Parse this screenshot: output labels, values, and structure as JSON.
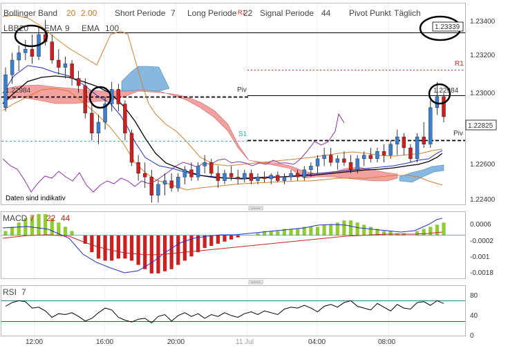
{
  "legend": {
    "bollinger_label": "Bollinger Band",
    "bollinger_period": "20",
    "bollinger_dev": "2.00",
    "short_label": "Short Periode",
    "short_value": "7",
    "long_label": "Long Periode",
    "long_value": "22",
    "signal_label": "Signal Periode",
    "signal_value": "44",
    "pivot_label": "Pivot Punkt",
    "pivot_value": "Täglich",
    "r1_marker": "R1",
    "line2_overlap": "LBB20",
    "ema9_label": "EMA",
    "ema9_value": "9",
    "ema100_label": "EMA",
    "ema100_value": "100"
  },
  "main_chart": {
    "price_labels": {
      "high_box": "1.23339",
      "piv_left": "1.22984",
      "piv_right": "1.22984",
      "last": "1.22825"
    },
    "level_labels": {
      "piv": "Piv",
      "r1": "R1",
      "s1": "S1",
      "piv_right": "Piv"
    },
    "note": "Daten sind indikativ",
    "y_ticks": [
      "1.23400",
      "1.23200",
      "1.23000",
      "1.22600",
      "1.22400"
    ]
  },
  "macd_panel": {
    "label": "MACD",
    "p1": "7",
    "p2": "22",
    "p3": "44",
    "y_ticks": [
      "0.0006",
      "-0.0002",
      "-0.001",
      "-0.0018"
    ]
  },
  "rsi_panel": {
    "label": "RSI",
    "period": "7",
    "y_ticks": [
      "80",
      "40",
      "0"
    ]
  },
  "x_ticks": [
    "12:00",
    "16:00",
    "20:00",
    "11 Jul",
    "04:00",
    "08:00"
  ],
  "colors": {
    "up_candle": "#3a7fd0",
    "down_candle": "#cc1f1f",
    "cloud_bull": "#f08f8f",
    "cloud_bear": "#7ab0dc",
    "bb_band": "#d47f2b",
    "ema_fast": "#1f2fc9",
    "ema_slow": "#000000",
    "macd_pos": "#8fcc2f",
    "macd_neg": "#cc1f1f",
    "lagging": "#8a2fb0",
    "rsi_line": "#000000",
    "rsi_bounds": "#2f7f9f"
  },
  "chart_data": {
    "type": "candlestick",
    "title": "",
    "x_labels": [
      "12:00",
      "16:00",
      "20:00",
      "11 Jul",
      "04:00",
      "08:00"
    ],
    "ylim": [
      1.2235,
      1.2345
    ],
    "pivot_levels": {
      "R1": 1.2318,
      "Piv": 1.22984,
      "S1": 1.2276,
      "Piv_right": 1.2273
    },
    "last_price": 1.22825,
    "high_marker": 1.23339,
    "candles": [
      {
        "o": 1.2288,
        "h": 1.231,
        "l": 1.2286,
        "c": 1.2306
      },
      {
        "o": 1.2306,
        "h": 1.2318,
        "l": 1.2301,
        "c": 1.2314
      },
      {
        "o": 1.2314,
        "h": 1.2322,
        "l": 1.2308,
        "c": 1.2318
      },
      {
        "o": 1.2318,
        "h": 1.2325,
        "l": 1.2314,
        "c": 1.232
      },
      {
        "o": 1.232,
        "h": 1.2328,
        "l": 1.2312,
        "c": 1.2316
      },
      {
        "o": 1.2316,
        "h": 1.2332,
        "l": 1.2314,
        "c": 1.2328
      },
      {
        "o": 1.2328,
        "h": 1.2336,
        "l": 1.2322,
        "c": 1.2324
      },
      {
        "o": 1.2324,
        "h": 1.2328,
        "l": 1.2312,
        "c": 1.2314
      },
      {
        "o": 1.2314,
        "h": 1.232,
        "l": 1.2306,
        "c": 1.231
      },
      {
        "o": 1.231,
        "h": 1.2316,
        "l": 1.2304,
        "c": 1.2312
      },
      {
        "o": 1.2312,
        "h": 1.2314,
        "l": 1.23,
        "c": 1.2304
      },
      {
        "o": 1.2304,
        "h": 1.2308,
        "l": 1.2296,
        "c": 1.23
      },
      {
        "o": 1.23,
        "h": 1.2304,
        "l": 1.2282,
        "c": 1.2285
      },
      {
        "o": 1.2285,
        "h": 1.229,
        "l": 1.227,
        "c": 1.2274
      },
      {
        "o": 1.2274,
        "h": 1.2284,
        "l": 1.2268,
        "c": 1.228
      },
      {
        "o": 1.228,
        "h": 1.2294,
        "l": 1.2276,
        "c": 1.229
      },
      {
        "o": 1.229,
        "h": 1.2302,
        "l": 1.2286,
        "c": 1.2298
      },
      {
        "o": 1.2298,
        "h": 1.2301,
        "l": 1.2286,
        "c": 1.229
      },
      {
        "o": 1.229,
        "h": 1.2292,
        "l": 1.227,
        "c": 1.2274
      },
      {
        "o": 1.2274,
        "h": 1.2276,
        "l": 1.2256,
        "c": 1.2258
      },
      {
        "o": 1.2258,
        "h": 1.2262,
        "l": 1.2248,
        "c": 1.2252
      },
      {
        "o": 1.2252,
        "h": 1.2258,
        "l": 1.2244,
        "c": 1.225
      },
      {
        "o": 1.225,
        "h": 1.2254,
        "l": 1.2236,
        "c": 1.224
      },
      {
        "o": 1.224,
        "h": 1.2248,
        "l": 1.2236,
        "c": 1.2246
      },
      {
        "o": 1.2246,
        "h": 1.2252,
        "l": 1.224,
        "c": 1.2248
      },
      {
        "o": 1.2248,
        "h": 1.2252,
        "l": 1.2242,
        "c": 1.2244
      },
      {
        "o": 1.2244,
        "h": 1.2252,
        "l": 1.2242,
        "c": 1.225
      },
      {
        "o": 1.225,
        "h": 1.2256,
        "l": 1.2246,
        "c": 1.2254
      },
      {
        "o": 1.2254,
        "h": 1.2258,
        "l": 1.2248,
        "c": 1.225
      },
      {
        "o": 1.225,
        "h": 1.2258,
        "l": 1.2248,
        "c": 1.2256
      },
      {
        "o": 1.2256,
        "h": 1.2262,
        "l": 1.2252,
        "c": 1.2258
      },
      {
        "o": 1.2258,
        "h": 1.226,
        "l": 1.225,
        "c": 1.2252
      },
      {
        "o": 1.2252,
        "h": 1.2256,
        "l": 1.2244,
        "c": 1.2248
      },
      {
        "o": 1.2248,
        "h": 1.2254,
        "l": 1.2246,
        "c": 1.2252
      },
      {
        "o": 1.2252,
        "h": 1.2256,
        "l": 1.2248,
        "c": 1.225
      },
      {
        "o": 1.225,
        "h": 1.2254,
        "l": 1.2246,
        "c": 1.2249
      },
      {
        "o": 1.2249,
        "h": 1.2254,
        "l": 1.2247,
        "c": 1.2252
      },
      {
        "o": 1.2252,
        "h": 1.2254,
        "l": 1.2246,
        "c": 1.2248
      },
      {
        "o": 1.2248,
        "h": 1.2252,
        "l": 1.2246,
        "c": 1.225
      },
      {
        "o": 1.225,
        "h": 1.2253,
        "l": 1.2247,
        "c": 1.2249
      },
      {
        "o": 1.2249,
        "h": 1.2252,
        "l": 1.2246,
        "c": 1.2251
      },
      {
        "o": 1.2251,
        "h": 1.2253,
        "l": 1.2247,
        "c": 1.2248
      },
      {
        "o": 1.2248,
        "h": 1.2252,
        "l": 1.2246,
        "c": 1.225
      },
      {
        "o": 1.225,
        "h": 1.2254,
        "l": 1.2248,
        "c": 1.2252
      },
      {
        "o": 1.2252,
        "h": 1.2254,
        "l": 1.2248,
        "c": 1.225
      },
      {
        "o": 1.225,
        "h": 1.2256,
        "l": 1.2248,
        "c": 1.2254
      },
      {
        "o": 1.2254,
        "h": 1.2258,
        "l": 1.225,
        "c": 1.2256
      },
      {
        "o": 1.2256,
        "h": 1.2262,
        "l": 1.2252,
        "c": 1.226
      },
      {
        "o": 1.226,
        "h": 1.2266,
        "l": 1.2256,
        "c": 1.2262
      },
      {
        "o": 1.2262,
        "h": 1.2266,
        "l": 1.2256,
        "c": 1.2258
      },
      {
        "o": 1.2258,
        "h": 1.2262,
        "l": 1.2254,
        "c": 1.226
      },
      {
        "o": 1.226,
        "h": 1.2264,
        "l": 1.2256,
        "c": 1.2258
      },
      {
        "o": 1.2258,
        "h": 1.2262,
        "l": 1.2252,
        "c": 1.2254
      },
      {
        "o": 1.2254,
        "h": 1.2262,
        "l": 1.2252,
        "c": 1.226
      },
      {
        "o": 1.226,
        "h": 1.2264,
        "l": 1.2256,
        "c": 1.2262
      },
      {
        "o": 1.2262,
        "h": 1.2266,
        "l": 1.2258,
        "c": 1.226
      },
      {
        "o": 1.226,
        "h": 1.2266,
        "l": 1.2258,
        "c": 1.2264
      },
      {
        "o": 1.2264,
        "h": 1.2268,
        "l": 1.2258,
        "c": 1.2262
      },
      {
        "o": 1.2262,
        "h": 1.227,
        "l": 1.226,
        "c": 1.2268
      },
      {
        "o": 1.2268,
        "h": 1.2276,
        "l": 1.2262,
        "c": 1.2272
      },
      {
        "o": 1.2272,
        "h": 1.2274,
        "l": 1.2262,
        "c": 1.2266
      },
      {
        "o": 1.2266,
        "h": 1.2268,
        "l": 1.2258,
        "c": 1.226
      },
      {
        "o": 1.226,
        "h": 1.2274,
        "l": 1.2258,
        "c": 1.2272
      },
      {
        "o": 1.2272,
        "h": 1.228,
        "l": 1.2266,
        "c": 1.2268
      },
      {
        "o": 1.2268,
        "h": 1.2292,
        "l": 1.2266,
        "c": 1.2288
      },
      {
        "o": 1.2288,
        "h": 1.2302,
        "l": 1.2284,
        "c": 1.2294
      },
      {
        "o": 1.2294,
        "h": 1.2296,
        "l": 1.228,
        "c": 1.2283
      }
    ],
    "macd": [
      0.0002,
      0.0004,
      0.0006,
      0.0008,
      0.0009,
      0.001,
      0.001,
      0.0008,
      0.0006,
      0.0004,
      0.0002,
      0.0,
      -0.0004,
      -0.0008,
      -0.0011,
      -0.0012,
      -0.0012,
      -0.0011,
      -0.0011,
      -0.0012,
      -0.0014,
      -0.0016,
      -0.0018,
      -0.0018,
      -0.0017,
      -0.0016,
      -0.0014,
      -0.0012,
      -0.001,
      -0.0008,
      -0.0006,
      -0.0005,
      -0.0004,
      -0.0003,
      -0.0002,
      -0.0001,
      0.0,
      0.0,
      0.0001,
      0.0002,
      0.0002,
      0.0002,
      0.0003,
      0.0003,
      0.0003,
      0.0004,
      0.0004,
      0.0004,
      0.0005,
      0.0005,
      0.0006,
      0.0007,
      0.0007,
      0.0006,
      0.0005,
      0.0004,
      0.0003,
      0.0002,
      0.0002,
      0.0001,
      0.0001,
      0.0,
      0.0002,
      0.0003,
      0.0004,
      0.0005,
      0.0006
    ],
    "rsi": [
      62,
      70,
      74,
      72,
      58,
      60,
      52,
      38,
      46,
      44,
      48,
      40,
      30,
      36,
      48,
      58,
      54,
      38,
      32,
      28,
      34,
      36,
      26,
      40,
      44,
      30,
      42,
      48,
      40,
      46,
      36,
      44,
      40,
      48,
      42,
      38,
      46,
      50,
      44,
      52,
      48,
      44,
      56,
      60,
      58,
      64,
      58,
      50,
      62,
      66,
      60,
      70,
      74,
      62,
      58,
      54,
      68,
      60,
      52,
      66,
      58,
      56,
      70,
      72,
      64,
      74,
      68
    ],
    "rsi_bounds": [
      70,
      30
    ]
  }
}
